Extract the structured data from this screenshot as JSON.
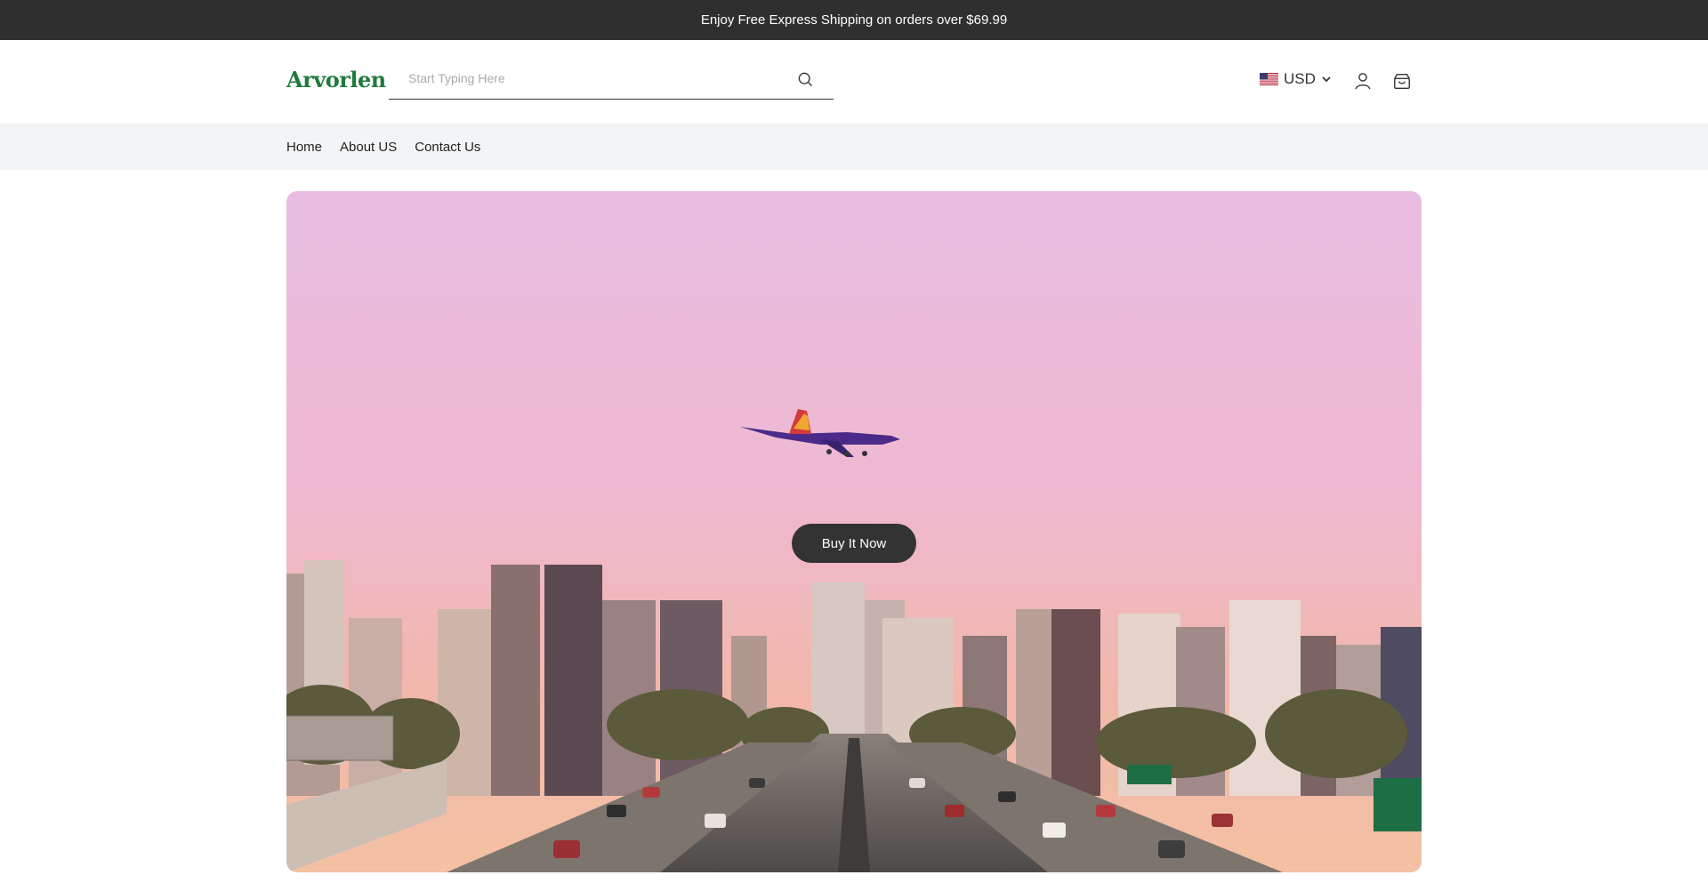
{
  "announcement": {
    "text": "Enjoy Free Express Shipping on orders over $69.99"
  },
  "header": {
    "logo": "Arvorlen",
    "search": {
      "placeholder": "Start Typing Here",
      "value": ""
    },
    "currency": {
      "label": "USD",
      "flag": "us-flag-icon"
    },
    "icons": [
      "search-icon",
      "chevron-down-icon",
      "account-icon",
      "cart-icon"
    ]
  },
  "nav": {
    "items": [
      {
        "label": "Home"
      },
      {
        "label": "About US"
      },
      {
        "label": "Contact Us"
      }
    ]
  },
  "hero": {
    "button_label": "Buy It Now",
    "colors": {
      "sky_top": "#e9bde2",
      "sky_bottom": "#f3b9a8",
      "button": "#333333"
    }
  },
  "colors": {
    "announcement_bg": "#2f2f2f",
    "nav_bg": "#f3f4f6",
    "brand": "#1f7a3c"
  }
}
